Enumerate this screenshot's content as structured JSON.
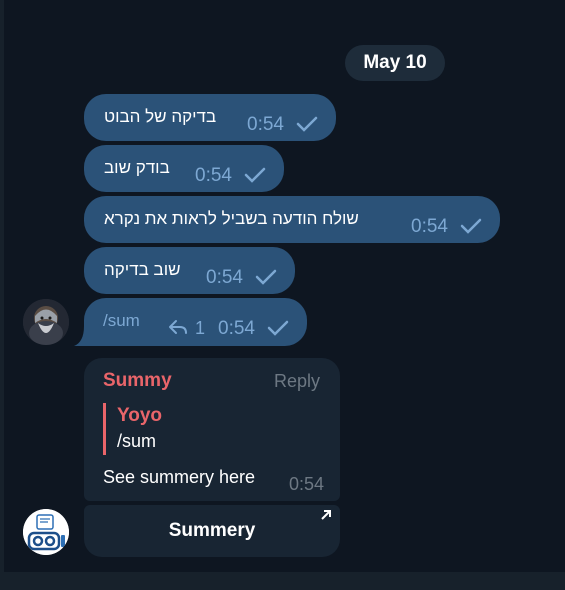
{
  "date_separator": "May 10",
  "messages": [
    {
      "text": "בדיקה של הבוט",
      "time": "0:54"
    },
    {
      "text": "בודק שוב",
      "time": "0:54"
    },
    {
      "text": "שולח הודעה בשביל לראות את נקרא",
      "time": "0:54"
    },
    {
      "text": "שוב בדיקה",
      "time": "0:54"
    },
    {
      "text": "/sum",
      "time": "0:54",
      "reply_count": "1"
    }
  ],
  "bot_reply": {
    "sender": "Summy",
    "reply_label": "Reply",
    "quote_sender": "Yoyo",
    "quote_text": "/sum",
    "text": "See summery here",
    "time": "0:54"
  },
  "inline_button": {
    "label": "Summery"
  },
  "colors": {
    "background": "#0e1621",
    "outgoing_bubble": "#2b5278",
    "incoming_bubble": "#182533",
    "bot_name": "#e9656a",
    "time_outgoing": "#7da8d3",
    "time_incoming": "#6d7883"
  },
  "icons": [
    "double-check-icon",
    "reply-arrow-icon",
    "external-link-arrow-icon"
  ]
}
